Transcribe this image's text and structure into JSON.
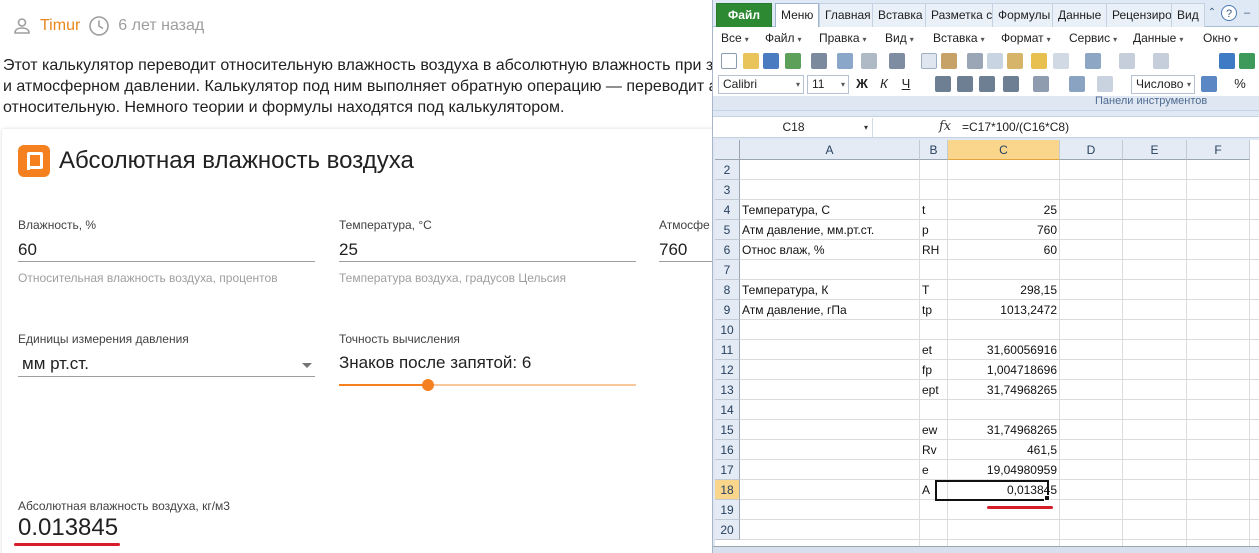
{
  "comment_meta": {
    "author": "Timur",
    "time_ago": "6 лет назад"
  },
  "intro_lines": [
    "Этот калькулятор переводит относительную влажность воздуха в абсолютную влажность при заданных температуре",
    "и атмосферном давлении. Калькулятор под ним выполняет обратную операцию — переводит абсолютную влажность в",
    "относительную. Немного теории и формулы находятся под калькулятором."
  ],
  "calculator": {
    "title": "Абсолютная влажность воздуха",
    "humidity": {
      "label": "Влажность, %",
      "value": "60",
      "help": "Относительная влажность воздуха, процентов"
    },
    "temperature": {
      "label": "Температура, °С",
      "value": "25",
      "help": "Температура воздуха, градусов Цельсия"
    },
    "pressure": {
      "label": "Атмосфе",
      "value": "760"
    },
    "pressure_units": {
      "label": "Единицы измерения давления",
      "value": "мм рт.ст."
    },
    "precision": {
      "label": "Точность вычисления",
      "value": "Знаков после запятой: 6",
      "slider_fraction": 0.3
    },
    "result": {
      "label": "Абсолютная влажность воздуха, кг/м3",
      "value": "0.013845"
    }
  },
  "spreadsheet": {
    "tabs": [
      "Файл",
      "Меню",
      "Главная",
      "Вставка",
      "Разметка с",
      "Формулы",
      "Данные",
      "Рецензиро",
      "Вид"
    ],
    "menu": [
      "Все",
      "Файл",
      "Правка",
      "Вид",
      "Вставка",
      "Формат",
      "Сервис",
      "Данные",
      "Окно"
    ],
    "font_name": "Calibri",
    "font_size": "11",
    "format_buttons": [
      "Ж",
      "К",
      "Ч"
    ],
    "number_format": "Числово",
    "percent_symbol": "%",
    "toolbar_group_label": "Панели инструментов",
    "name_box": "C18",
    "fx_label": "fx",
    "formula": "=C17*100/(C16*C8)",
    "column_headers": [
      "A",
      "B",
      "C",
      "D",
      "E",
      "F"
    ],
    "selected_column": "C",
    "selected_row": "18",
    "rows": [
      {
        "num": "2",
        "a": "",
        "b": "",
        "c": ""
      },
      {
        "num": "3",
        "a": "",
        "b": "",
        "c": ""
      },
      {
        "num": "4",
        "a": "Температура, С",
        "b": "t",
        "c": "25"
      },
      {
        "num": "5",
        "a": "Атм давление, мм.рт.ст.",
        "b": "p",
        "c": "760"
      },
      {
        "num": "6",
        "a": "Относ влаж, %",
        "b": "RH",
        "c": "60"
      },
      {
        "num": "7",
        "a": "",
        "b": "",
        "c": ""
      },
      {
        "num": "8",
        "a": "Температура, К",
        "b": "T",
        "c": "298,15"
      },
      {
        "num": "9",
        "a": "Атм давление, гПа",
        "b": "tp",
        "c": "1013,2472"
      },
      {
        "num": "10",
        "a": "",
        "b": "",
        "c": ""
      },
      {
        "num": "11",
        "a": "",
        "b": "et",
        "c": "31,60056916"
      },
      {
        "num": "12",
        "a": "",
        "b": "fp",
        "c": "1,004718696"
      },
      {
        "num": "13",
        "a": "",
        "b": "ept",
        "c": "31,74968265"
      },
      {
        "num": "14",
        "a": "",
        "b": "",
        "c": ""
      },
      {
        "num": "15",
        "a": "",
        "b": "ew",
        "c": "31,74968265"
      },
      {
        "num": "16",
        "a": "",
        "b": "Rv",
        "c": "461,5"
      },
      {
        "num": "17",
        "a": "",
        "b": "e",
        "c": "19,04980959"
      },
      {
        "num": "18",
        "a": "",
        "b": "A",
        "c": "0,013845"
      },
      {
        "num": "19",
        "a": "",
        "b": "",
        "c": ""
      },
      {
        "num": "20",
        "a": "",
        "b": "",
        "c": ""
      }
    ]
  },
  "colors": {
    "accent_orange": "#f4801f",
    "highlight_red": "#d81d2a",
    "excel_file_tab": "#2d8a32",
    "selected_header": "#f9d68c"
  }
}
